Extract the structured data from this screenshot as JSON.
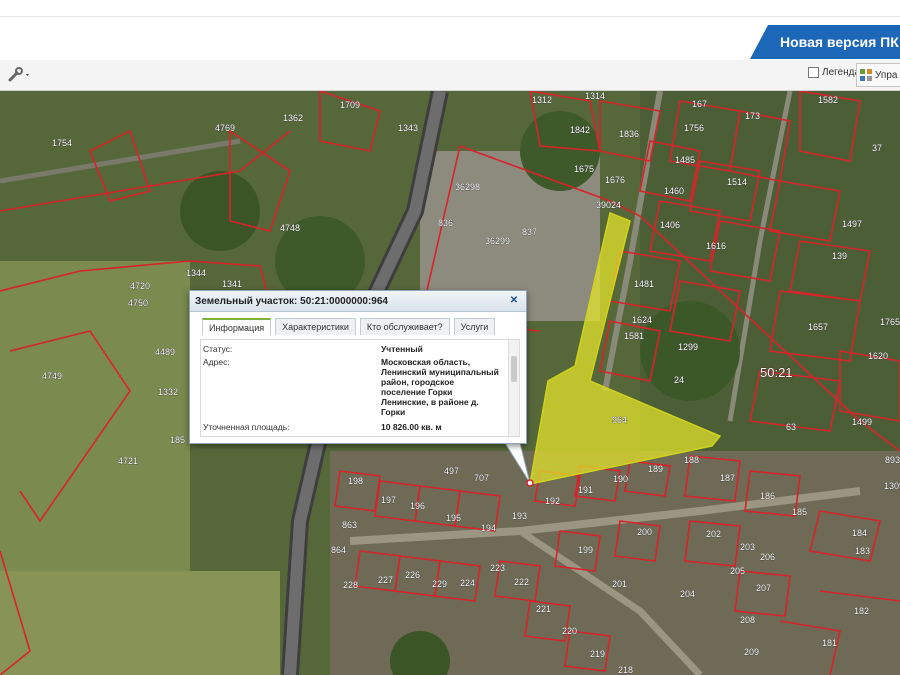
{
  "header": {
    "new_version_label": "Новая версия ПК"
  },
  "toolbar": {
    "tool_icon": "wrench-icon",
    "legend_label": "Легенда",
    "manage_label": "Упра"
  },
  "map": {
    "district_label": "50:21",
    "parcel_labels": {
      "p1709": "1709",
      "p1343": "1343",
      "p1362": "1362",
      "p4769": "4769",
      "p1754": "1754",
      "p4748": "4748",
      "p36298": "36298",
      "p4750": "4750",
      "p4720": "4720",
      "p1344": "1344",
      "p1341": "1341",
      "p4749": "4749",
      "p4489": "4489",
      "p1332": "1332",
      "p185": "185",
      "p4721": "4721",
      "p836": "836",
      "p837": "837",
      "p36299": "36299",
      "p39024": "39024",
      "p1675": "1675",
      "p1676": "1676",
      "p1842": "1842",
      "p1836": "1836",
      "p1312": "1312",
      "p1314": "1314",
      "p167": "167",
      "p1756": "1756",
      "p173": "173",
      "p1582": "1582",
      "p37": "37",
      "p1485": "1485",
      "p1460": "1460",
      "p1514": "1514",
      "p1406": "1406",
      "p1616": "1616",
      "p1497": "1497",
      "p139": "139",
      "p1481": "1481",
      "p1624": "1624",
      "p1581": "1581",
      "p1299": "1299",
      "p1657": "1657",
      "p1765": "1765",
      "p1620": "1620",
      "p24": "24",
      "p63": "63",
      "p1499": "1499",
      "p964": "964",
      "p497": "497",
      "p707": "707",
      "p189": "189",
      "p190": "190",
      "p188": "188",
      "p187": "187",
      "p186": "186",
      "p185b": "185",
      "p184": "184",
      "p183": "183",
      "p192": "192",
      "p191": "191",
      "p193": "193",
      "p194": "194",
      "p195": "195",
      "p196": "196",
      "p197": "197",
      "p198": "198",
      "p863": "863",
      "p864": "864",
      "p228": "228",
      "p227": "227",
      "p226": "226",
      "p229": "229",
      "p224": "224",
      "p223": "223",
      "p222": "222",
      "p221": "221",
      "p220": "220",
      "p219": "219",
      "p218": "218",
      "p199": "199",
      "p200": "200",
      "p201": "201",
      "p202": "202",
      "p203": "203",
      "p204": "204",
      "p205": "205",
      "p206": "206",
      "p207": "207",
      "p208": "208",
      "p209": "209",
      "p181": "181",
      "p182": "182",
      "p1309": "1309",
      "p893": "893"
    }
  },
  "popup": {
    "title": "Земельный участок: 50:21:0000000:964",
    "close_icon": "close-icon",
    "tabs": [
      "Информация",
      "Характеристики",
      "Кто обслуживает?",
      "Услуги"
    ],
    "status_label": "Статус:",
    "status_value": "Учтенный",
    "address_label": "Адрес:",
    "address_line1": "Московская область,",
    "address_line2": "Ленинский муниципальный",
    "address_line3": "район, городское",
    "address_line4": "поселение Горки",
    "address_line5": "Ленинские, в районе д.",
    "address_line6": "Горки",
    "area_label": "Уточненная площадь:",
    "area_value": "10 826.00 кв. м"
  }
}
